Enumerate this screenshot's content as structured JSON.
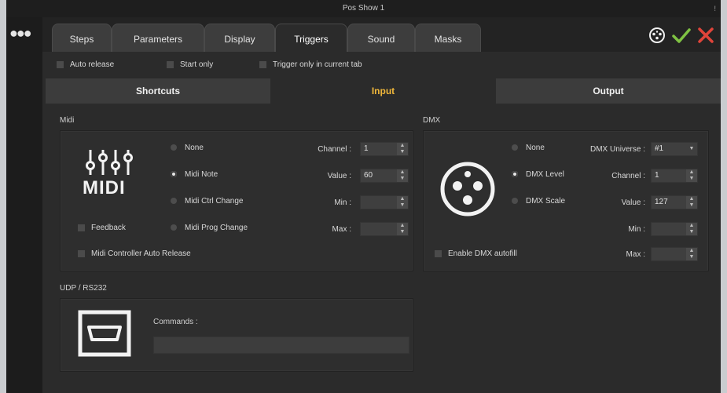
{
  "window": {
    "title": "Pos Show 1",
    "pin": "!"
  },
  "tabs": [
    "Steps",
    "Parameters",
    "Display",
    "Triggers",
    "Sound",
    "Masks"
  ],
  "options": {
    "auto_release": "Auto release",
    "start_only": "Start only",
    "trigger_current_tab": "Trigger only in current tab"
  },
  "subtabs": {
    "shortcuts": "Shortcuts",
    "input": "Input",
    "output": "Output"
  },
  "midi": {
    "section": "Midi",
    "logo_text": "MIDI",
    "radios": [
      "None",
      "Midi Note",
      "Midi Ctrl Change",
      "Midi Prog Change"
    ],
    "selected": "Midi Note",
    "feedback": "Feedback",
    "auto_release": "Midi Controller Auto Release",
    "fields": {
      "channel_label": "Channel :",
      "channel_value": "1",
      "value_label": "Value :",
      "value_value": "60",
      "min_label": "Min :",
      "min_value": "",
      "max_label": "Max :",
      "max_value": ""
    }
  },
  "dmx": {
    "section": "DMX",
    "radios": [
      "None",
      "DMX Level",
      "DMX Scale"
    ],
    "selected": "DMX Level",
    "autofill": "Enable DMX autofill",
    "fields": {
      "universe_label": "DMX Universe :",
      "universe_value": "#1",
      "channel_label": "Channel :",
      "channel_value": "1",
      "value_label": "Value :",
      "value_value": "127",
      "min_label": "Min :",
      "min_value": "",
      "max_label": "Max :",
      "max_value": ""
    }
  },
  "udp": {
    "section": "UDP / RS232",
    "commands_label": "Commands :",
    "commands_value": ""
  },
  "icons": {
    "menu": "more-dots-icon",
    "dmx": "dmx-connector-icon",
    "confirm": "checkmark-icon",
    "cancel": "close-icon",
    "serial": "serial-port-icon",
    "midi": "midi-sliders-icon"
  },
  "colors": {
    "accent": "#f0b73a",
    "confirm": "#7fc243",
    "cancel": "#e0443a"
  }
}
